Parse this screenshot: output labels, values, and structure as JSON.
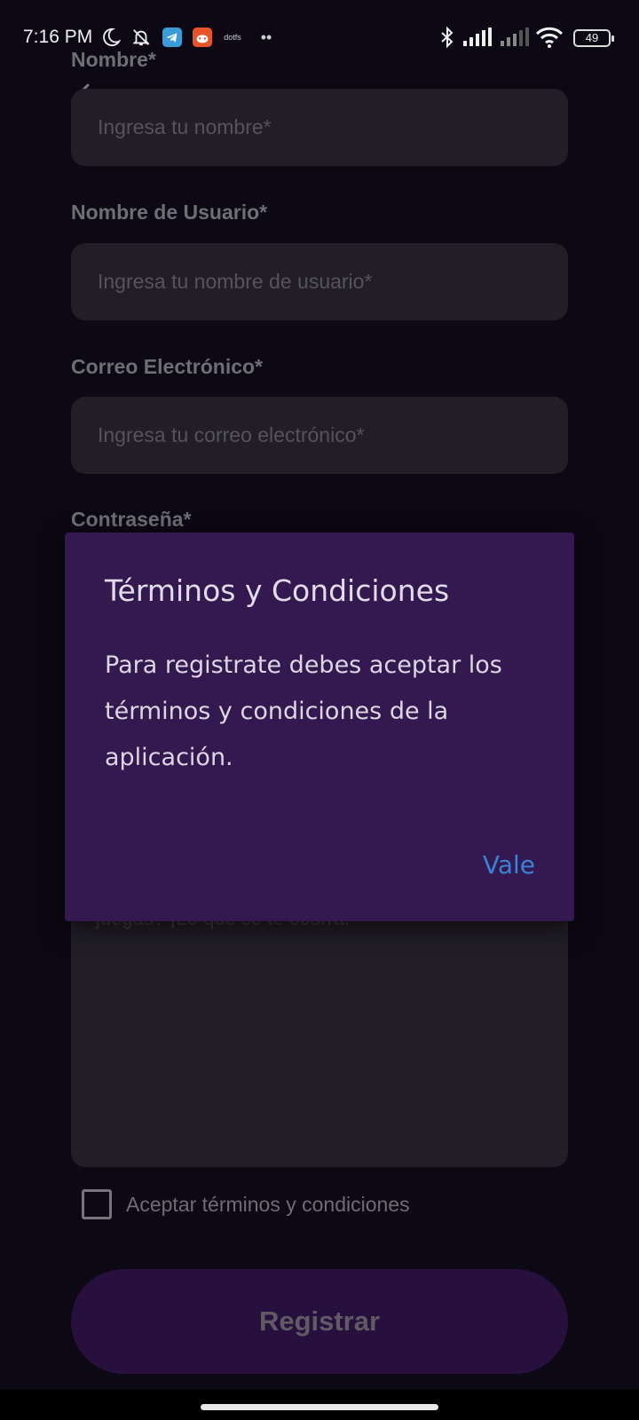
{
  "status_bar": {
    "time": "7:16 PM",
    "battery": "49",
    "app_icon_text": "dotfs"
  },
  "form": {
    "name_label": "Nombre*",
    "name_placeholder": "Ingresa tu nombre*",
    "username_label": "Nombre de Usuario*",
    "username_placeholder": "Ingresa tu nombre de usuario*",
    "email_label": "Correo Electrónico*",
    "email_placeholder": "Ingresa tu correo electrónico*",
    "password_label": "Contraseña*",
    "bio_placeholder_partial": "juegas? ¡Lo que se te ocurra!",
    "terms_checkbox_label": "Aceptar términos y condiciones",
    "register_button": "Registrar"
  },
  "dialog": {
    "title": "Términos y Condiciones",
    "body": "Para registrate debes aceptar los términos y condiciones de la aplicación.",
    "ok_button": "Vale"
  },
  "colors": {
    "background": "#0c0814",
    "dialog_bg": "#33194f",
    "accent_link": "#3a82d8",
    "register_bg": "#28103e"
  }
}
